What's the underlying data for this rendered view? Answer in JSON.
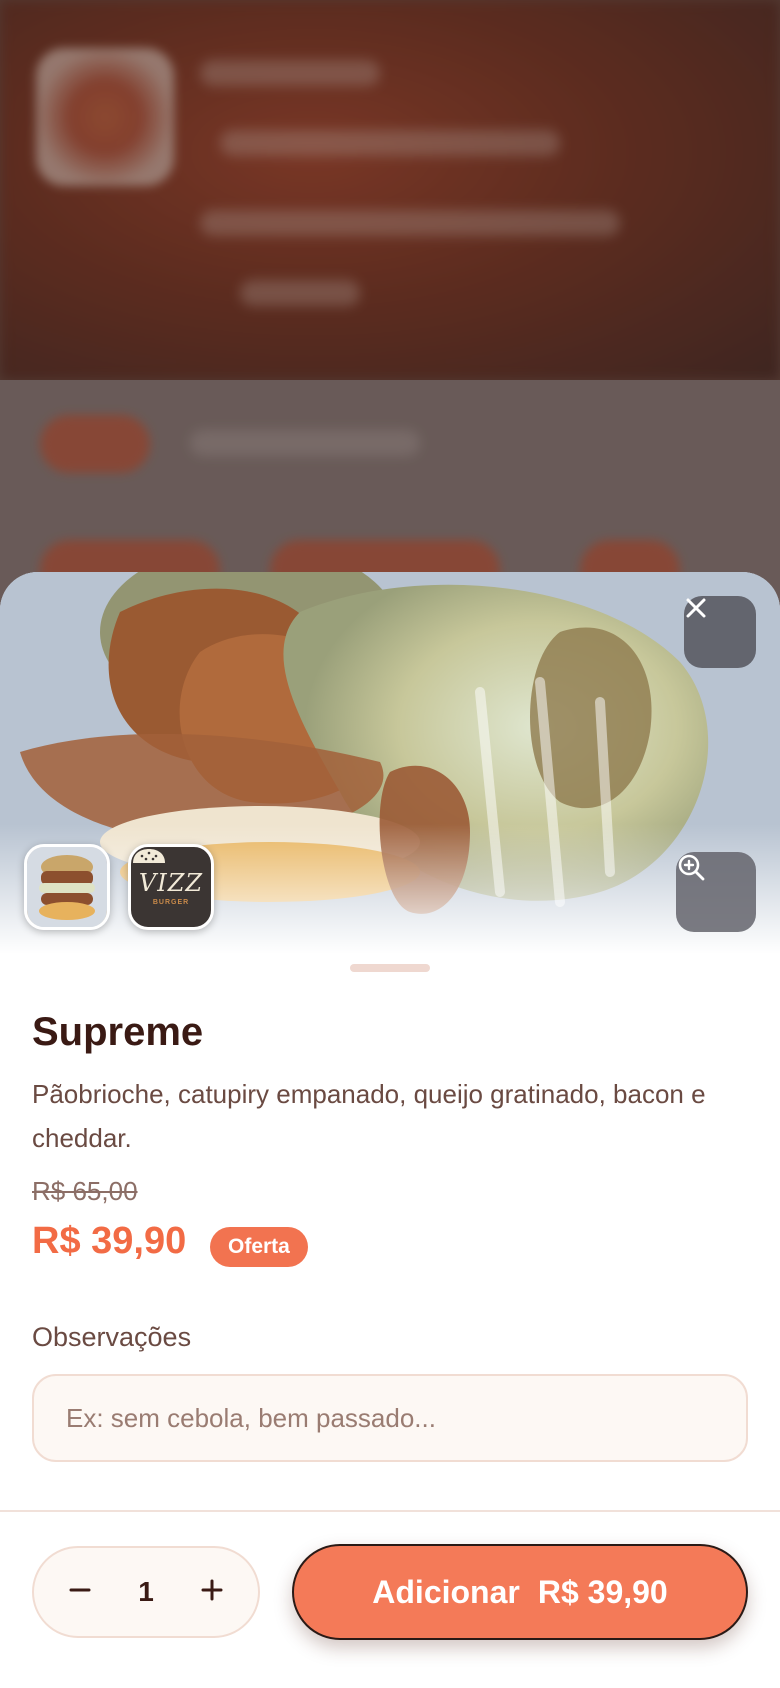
{
  "product": {
    "name": "Supreme",
    "description": "Pãobrioche, catupiry empanado, queijo gratinado, bacon e cheddar.",
    "old_price": "R$ 65,00",
    "price": "R$ 39,90",
    "badge": "Oferta"
  },
  "gallery": {
    "thumbnails": [
      "burger-photo",
      "vizz-burger-logo"
    ],
    "logo_text": "VIZZ",
    "logo_sub": "BURGER"
  },
  "notes": {
    "label": "Observações",
    "placeholder": "Ex: sem cebola, bem passado..."
  },
  "quantity": {
    "value": "1"
  },
  "cta": {
    "label": "Adicionar",
    "price": "R$ 39,90"
  },
  "icons": {
    "close": "close-icon",
    "zoom": "zoom-in-icon",
    "minus": "minus-icon",
    "plus": "plus-icon"
  },
  "colors": {
    "accent": "#f26b45",
    "title": "#3a1a14",
    "text": "#6a4a42"
  }
}
